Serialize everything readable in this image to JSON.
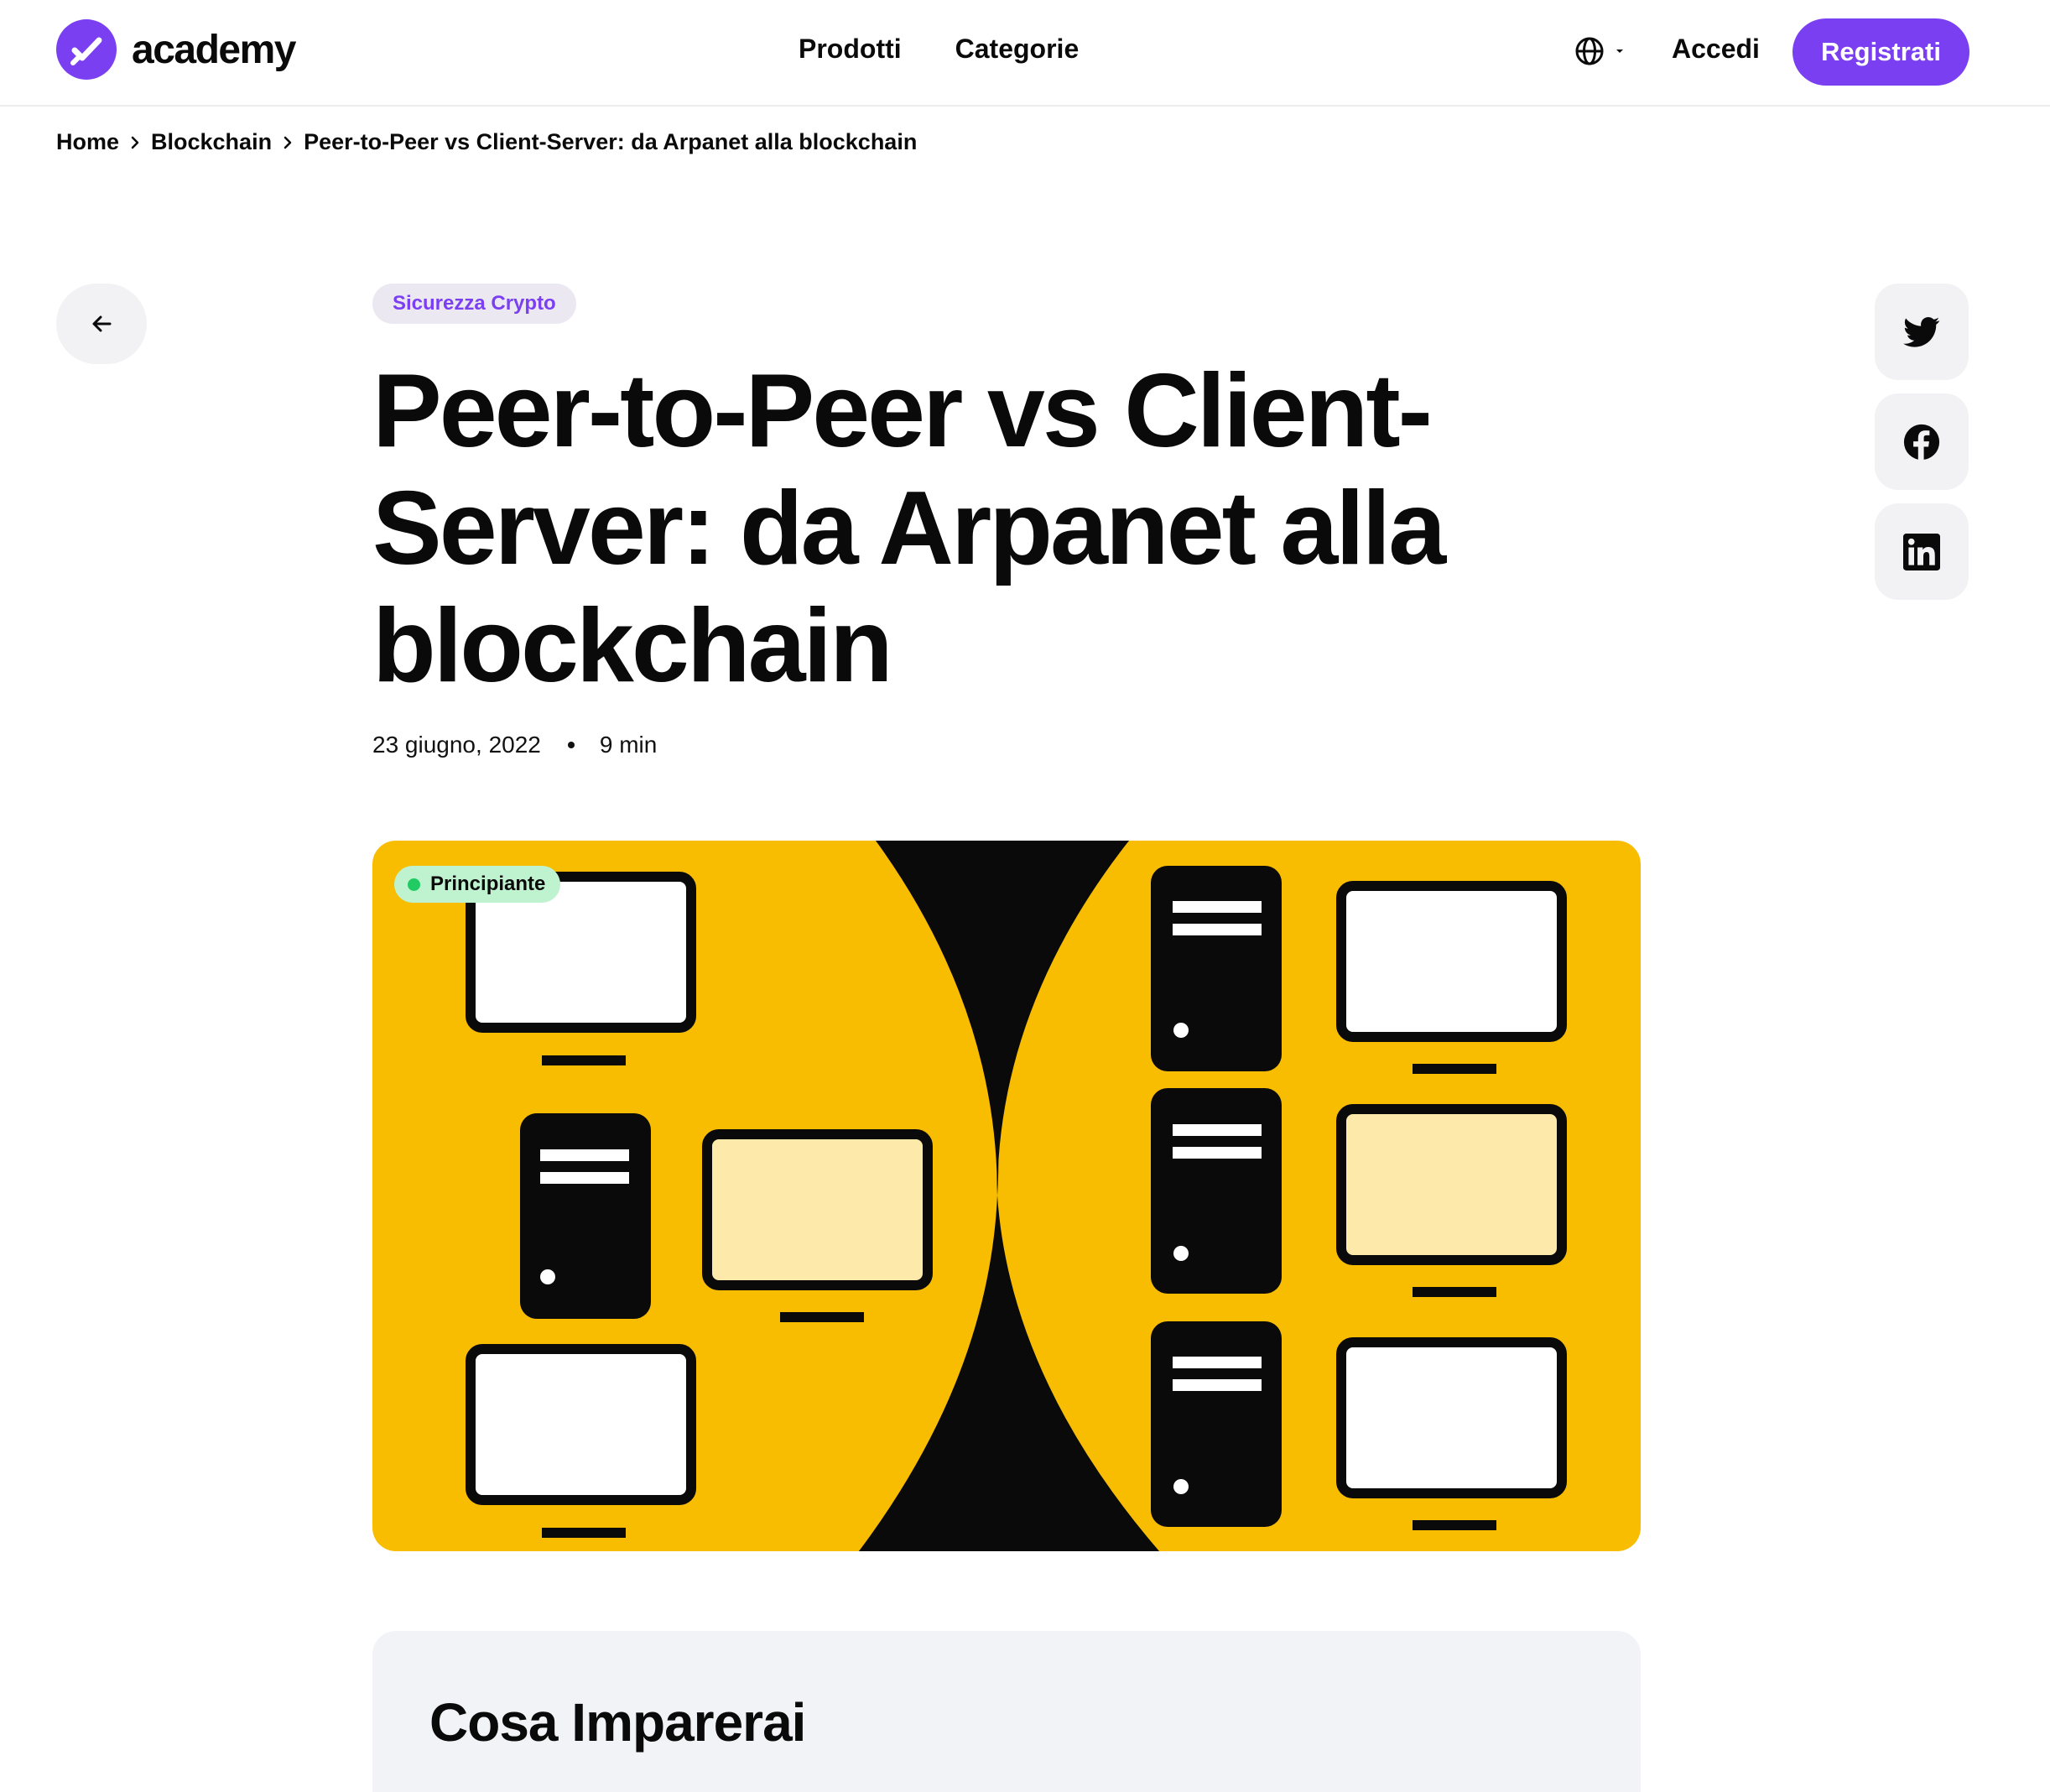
{
  "header": {
    "logo_text": "academy",
    "nav": [
      "Prodotti",
      "Categorie"
    ],
    "login_label": "Accedi",
    "signup_label": "Registrati",
    "brand_color": "#7b3ff2"
  },
  "breadcrumb": [
    "Home",
    "Blockchain",
    "Peer-to-Peer vs Client-Server: da Arpanet alla blockchain"
  ],
  "article": {
    "tag": "Sicurezza Crypto",
    "title": "Peer-to-Peer vs Client-Server: da Arpanet alla blockchain",
    "date": "23 giugno, 2022",
    "read_time": "9 min",
    "level_badge": "Principiante",
    "hero_colors": {
      "background": "#f8bc00",
      "highlight_screen": "#fde9a9",
      "dark": "#0a0a0a"
    }
  },
  "social": [
    "twitter-icon",
    "facebook-icon",
    "linkedin-icon"
  ],
  "learn_section": {
    "title": "Cosa Imparerai"
  }
}
